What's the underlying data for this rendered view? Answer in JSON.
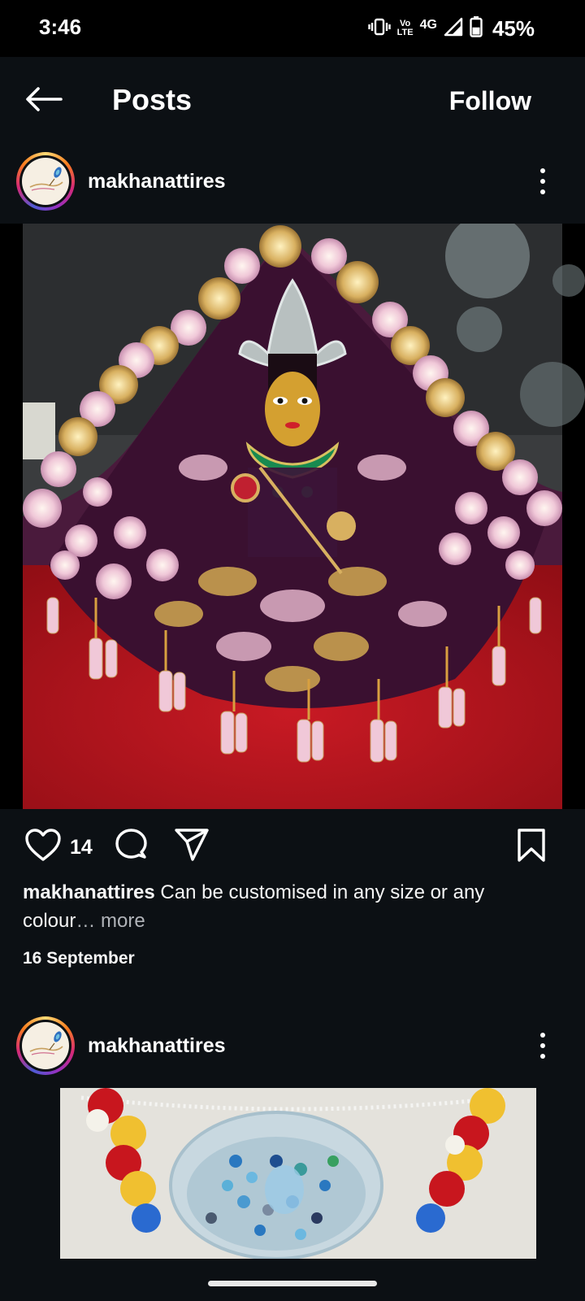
{
  "status_bar": {
    "time": "3:46",
    "volte_top": "Vo",
    "volte_bottom": "LTE",
    "network": "4G",
    "battery": "45%",
    "battery_level": 0.45
  },
  "header": {
    "title": "Posts",
    "follow_label": "Follow"
  },
  "posts": [
    {
      "username": "makhanattires",
      "likes": "14",
      "caption_user": "makhanattires",
      "caption_text": " Can be customised in any size or any colour",
      "caption_more": "… more",
      "date": "16 September"
    },
    {
      "username": "makhanattires"
    }
  ],
  "icons": [
    "back-arrow-icon",
    "heart-icon",
    "comment-icon",
    "share-icon",
    "bookmark-icon",
    "more-icon"
  ]
}
